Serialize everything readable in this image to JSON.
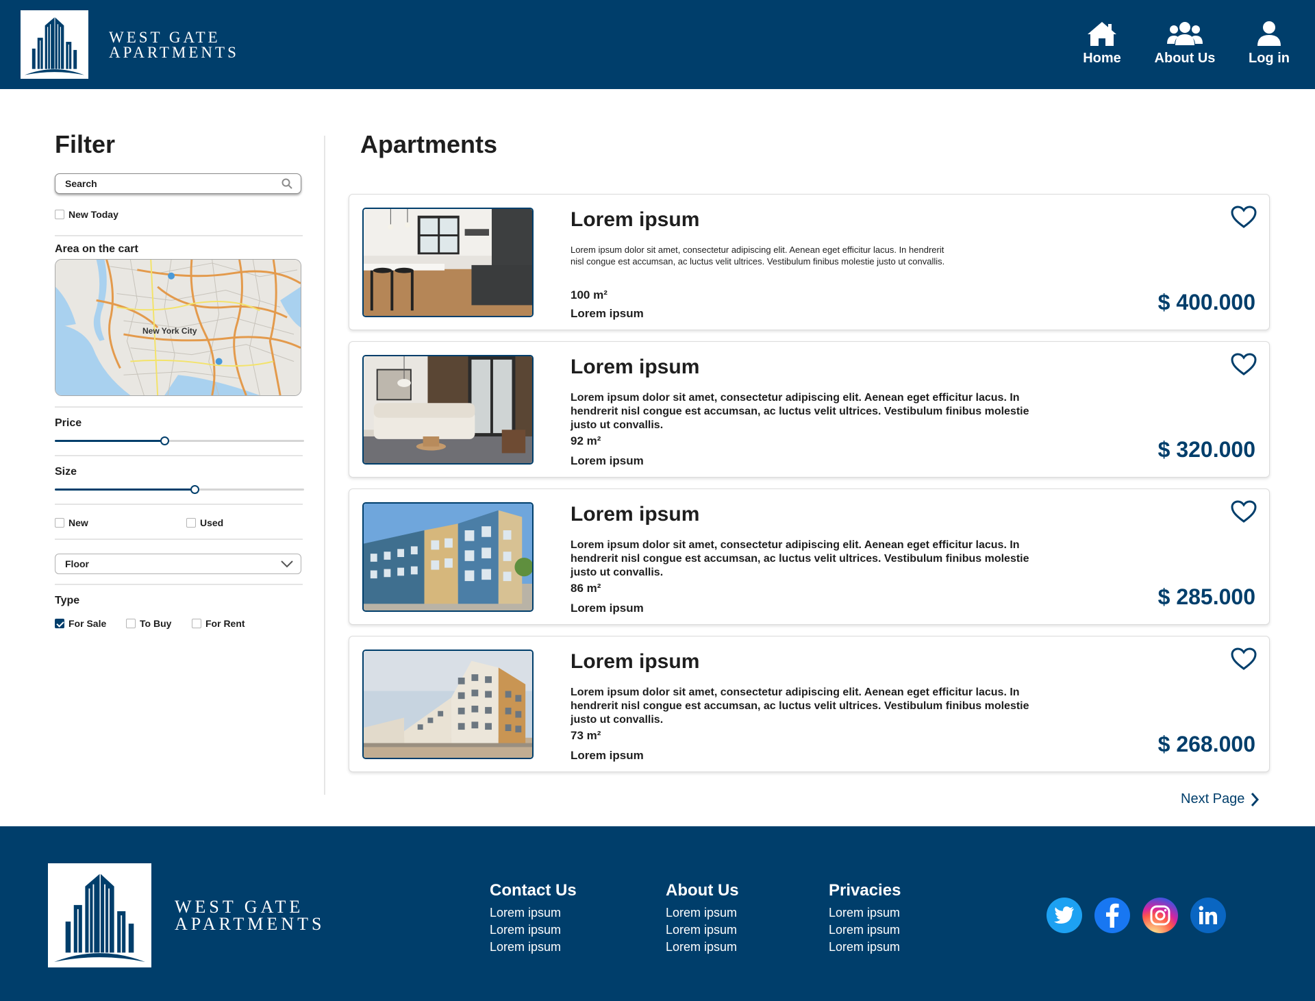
{
  "brand": {
    "line1": "WEST GATE",
    "line2": "APARTMENTS"
  },
  "nav": [
    {
      "label": "Home",
      "icon": "home-icon"
    },
    {
      "label": "About Us",
      "icon": "users-icon"
    },
    {
      "label": "Log in",
      "icon": "user-icon"
    }
  ],
  "filter": {
    "title": "Filter",
    "search": {
      "placeholder": "Search",
      "value": ""
    },
    "new_today": {
      "label": "New Today",
      "checked": false
    },
    "area_label": "Area on the cart",
    "map_city_label": "New York City",
    "price": {
      "label": "Price",
      "level": 0.44
    },
    "size": {
      "label": "Size",
      "level": 0.56
    },
    "condition": [
      {
        "label": "New",
        "checked": false
      },
      {
        "label": "Used",
        "checked": false
      }
    ],
    "floor": {
      "value": "Floor"
    },
    "type_label": "Type",
    "types": [
      {
        "label": "For Sale",
        "checked": true
      },
      {
        "label": "To Buy",
        "checked": false
      },
      {
        "label": "For Rent",
        "checked": false
      }
    ]
  },
  "main": {
    "title": "Apartments",
    "listings": [
      {
        "title": "Lorem ipsum",
        "description": "Lorem ipsum dolor sit amet, consectetur adipiscing elit. Aenean eget efficitur lacus. In hendrerit nisl congue est accumsan, ac luctus velit ultrices. Vestibulum finibus molestie justo ut convallis.",
        "size": "100 m²",
        "subtitle": "Lorem ipsum",
        "price": "$ 400.000"
      },
      {
        "title": "Lorem ipsum",
        "description": "Lorem ipsum dolor sit amet, consectetur adipiscing elit. Aenean eget efficitur lacus. In hendrerit nisl congue est accumsan, ac luctus velit ultrices. Vestibulum finibus molestie justo ut convallis.",
        "size": "92 m²",
        "subtitle": "Lorem ipsum",
        "price": "$ 320.000"
      },
      {
        "title": "Lorem ipsum",
        "description": "Lorem ipsum dolor sit amet, consectetur adipiscing elit. Aenean eget efficitur lacus. In hendrerit nisl congue est accumsan, ac luctus velit ultrices. Vestibulum finibus molestie justo ut convallis.",
        "size": "86 m²",
        "subtitle": "Lorem ipsum",
        "price": "$ 285.000"
      },
      {
        "title": "Lorem ipsum",
        "description": "Lorem ipsum dolor sit amet, consectetur adipiscing elit. Aenean eget efficitur lacus. In hendrerit nisl congue est accumsan, ac luctus velit ultrices. Vestibulum finibus molestie justo ut convallis.",
        "size": "73 m²",
        "subtitle": "Lorem ipsum",
        "price": "$ 268.000"
      }
    ],
    "next_page": "Next Page"
  },
  "footer": {
    "columns": [
      {
        "title": "Contact Us",
        "links": [
          "Lorem ipsum",
          "Lorem ipsum",
          "Lorem ipsum"
        ]
      },
      {
        "title": "About Us",
        "links": [
          "Lorem ipsum",
          "Lorem ipsum",
          "Lorem ipsum"
        ]
      },
      {
        "title": "Privacies",
        "links": [
          "Lorem ipsum",
          "Lorem ipsum",
          "Lorem ipsum"
        ]
      }
    ],
    "social": [
      "twitter-icon",
      "facebook-icon",
      "instagram-icon",
      "linkedin-icon"
    ]
  },
  "colors": {
    "brand": "#003e6b",
    "background": "#ffffff",
    "text": "#1e1e1e"
  }
}
